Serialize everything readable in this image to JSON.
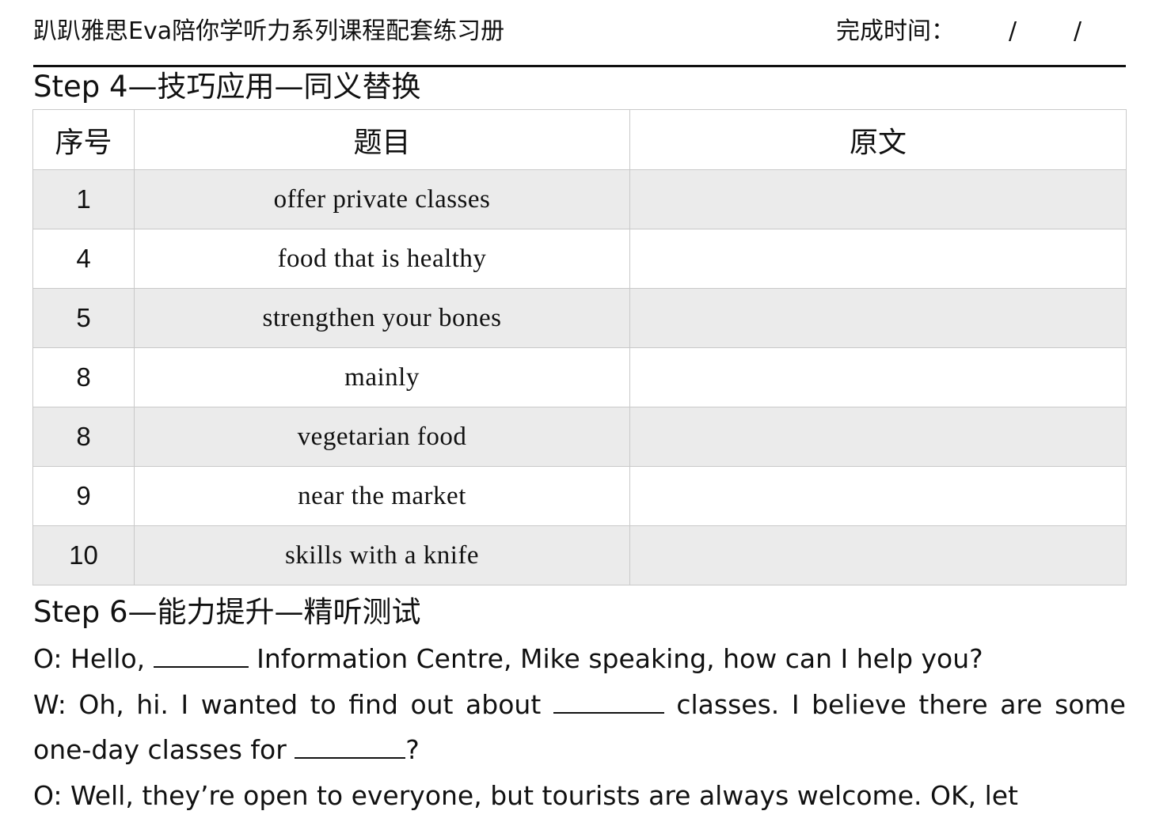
{
  "header": {
    "title": "趴趴雅思Eva陪你学听力系列课程配套练习册",
    "completion_label": "完成时间：",
    "slash": "/"
  },
  "step4": {
    "heading": "Step 4—技巧应用—同义替换"
  },
  "table": {
    "columns": [
      "序号",
      "题目",
      "原文"
    ],
    "rows": [
      {
        "no": "1",
        "item": "offer private classes",
        "original": ""
      },
      {
        "no": "4",
        "item": "food that is healthy",
        "original": ""
      },
      {
        "no": "5",
        "item": "strengthen your bones",
        "original": ""
      },
      {
        "no": "8",
        "item": "mainly",
        "original": ""
      },
      {
        "no": "8",
        "item": "vegetarian food",
        "original": ""
      },
      {
        "no": "9",
        "item": "near the market",
        "original": ""
      },
      {
        "no": "10",
        "item": "skills with a knife",
        "original": ""
      }
    ]
  },
  "step6": {
    "heading": "Step 6—能力提升—精听测试"
  },
  "dialog": {
    "line1_a": "O: Hello, ",
    "line1_b": " Information Centre, Mike speaking, how can I help you?",
    "line2_a": "W: Oh, hi. I wanted to find out about ",
    "line2_b": " classes. I believe there are some one-day classes for ",
    "line2_c": "?",
    "line3": "O: Well, they’re open to everyone, but tourists are always welcome. OK, let"
  },
  "colors": {
    "text": "#111111",
    "shaded_row": "#ebebeb",
    "grid": "#c9c9c9"
  }
}
